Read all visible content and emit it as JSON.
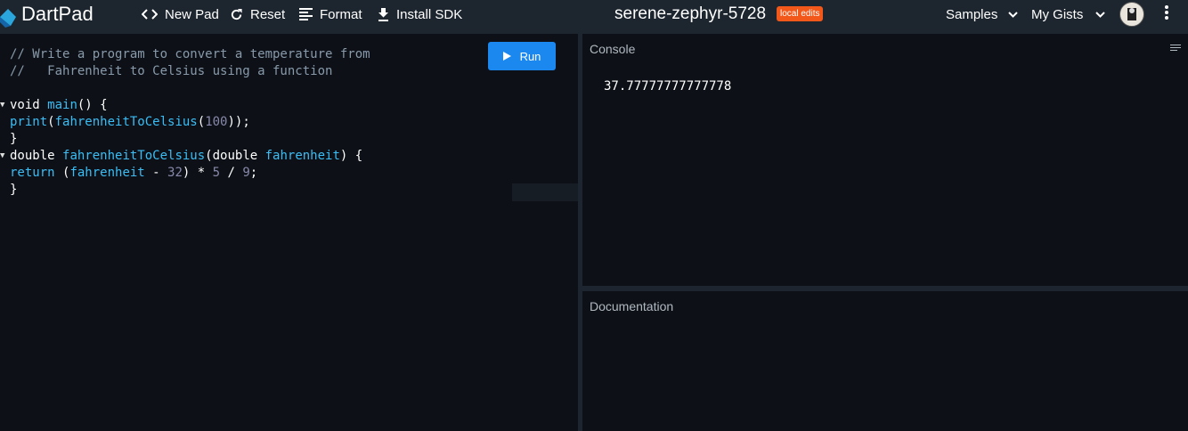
{
  "header": {
    "app_title": "DartPad",
    "new_pad_label": "New Pad",
    "reset_label": "Reset",
    "format_label": "Format",
    "install_sdk_label": "Install SDK",
    "pad_name": "serene-zephyr-5728",
    "badge_label": "local edits",
    "samples_label": "Samples",
    "my_gists_label": "My Gists",
    "icons": [
      "dart-logo-icon",
      "code-brackets-icon",
      "refresh-icon",
      "format-align-icon",
      "download-icon",
      "chevron-down-icon",
      "avatar",
      "more-vert-icon"
    ],
    "badge_color": "#f2581a"
  },
  "editor": {
    "run_label": "Run",
    "run_color": "#1b88f0",
    "lines": {
      "l1": "// Write a program to convert a temperature from",
      "l2": "//   Fahrenheit to Celsius using a function",
      "l4_a": "void ",
      "l4_b": "main",
      "l4_c": "() {",
      "l5_a": "print",
      "l5_b": "(",
      "l5_c": "fahrenheitToCelsius",
      "l5_d": "(",
      "l5_e": "100",
      "l5_f": "));",
      "l6": "}",
      "l7_a": "double ",
      "l7_b": "fahrenheitToCelsius",
      "l7_c": "(double ",
      "l7_d": "fahrenheit",
      "l7_e": ") {",
      "l8_a": "return ",
      "l8_b": "(",
      "l8_c": "fahrenheit",
      "l8_d": " - ",
      "l8_e": "32",
      "l8_f": ") * ",
      "l8_g": "5",
      "l8_h": " / ",
      "l8_i": "9",
      "l8_j": ";",
      "l9": "}"
    }
  },
  "console": {
    "title": "Console",
    "output": "37.77777777777778"
  },
  "docs": {
    "title": "Documentation"
  }
}
